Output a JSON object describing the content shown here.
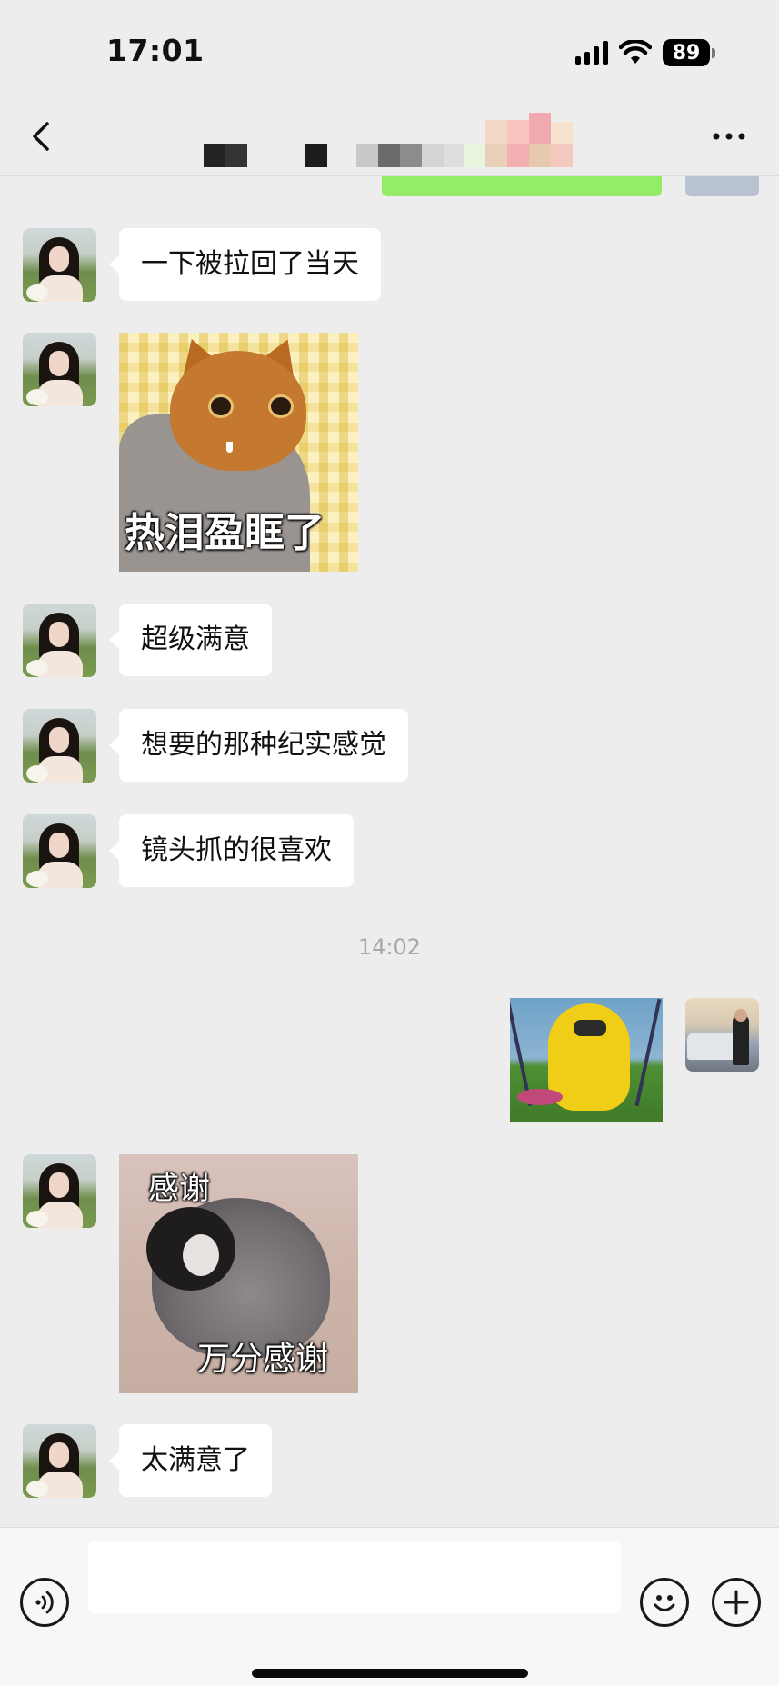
{
  "status_bar": {
    "time": "17:01",
    "battery": "89"
  },
  "nav": {
    "title": "",
    "back_icon": "chevron-left-icon",
    "more_icon": "more-horizontal-icon"
  },
  "messages": [
    {
      "type": "text",
      "side": "left",
      "text": "一下被拉回了当天"
    },
    {
      "type": "sticker",
      "side": "left",
      "name": "cat-crying-sticker",
      "caption": "热泪盈眶了"
    },
    {
      "type": "text",
      "side": "left",
      "text": "超级满意"
    },
    {
      "type": "text",
      "side": "left",
      "text": "想要的那种纪实感觉"
    },
    {
      "type": "text",
      "side": "left",
      "text": "镜头抓的很喜欢"
    },
    {
      "type": "time",
      "text": "14:02"
    },
    {
      "type": "image",
      "side": "right",
      "name": "teddy-swing-sticker"
    },
    {
      "type": "sticker",
      "side": "left",
      "name": "penguin-thanks-sticker",
      "caption_top": "感谢",
      "caption_bottom": "万分感谢"
    },
    {
      "type": "text",
      "side": "left",
      "text": "太满意了"
    }
  ],
  "input_bar": {
    "voice_icon": "voice-icon",
    "text_value": "",
    "emoji_icon": "emoji-icon",
    "add_icon": "plus-circle-icon"
  },
  "colors": {
    "background": "#ededed",
    "bubble_left": "#ffffff",
    "bubble_right": "#95ec69",
    "timestamp": "#a8a8a8"
  }
}
